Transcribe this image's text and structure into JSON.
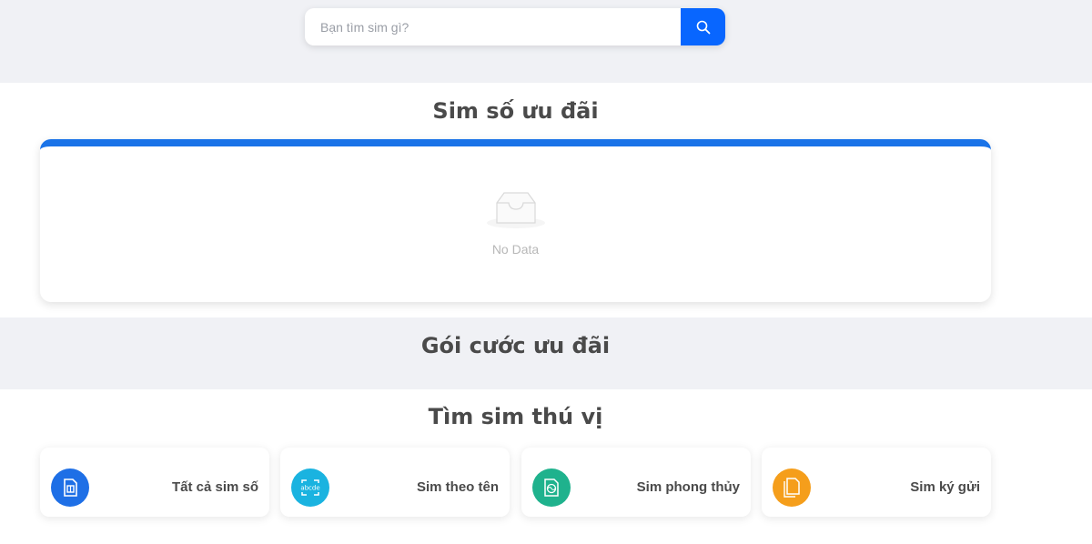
{
  "search": {
    "placeholder": "Bạn tìm sim gì?",
    "value": ""
  },
  "sections": {
    "promo_sims": {
      "title": "Sim số ưu đãi",
      "empty_text": "No Data"
    },
    "promo_packages": {
      "title": "Gói cước ưu đãi"
    },
    "interesting_sims": {
      "title": "Tìm sim thú vị",
      "categories": [
        {
          "label": "Tất cả sim số",
          "icon": "sim-card-icon"
        },
        {
          "label": "Sim theo tên",
          "icon": "name-tag-icon"
        },
        {
          "label": "Sim phong thủy",
          "icon": "feng-shui-icon"
        },
        {
          "label": "Sim ký gửi",
          "icon": "documents-icon"
        }
      ]
    }
  },
  "colors": {
    "accent": "#0866ff",
    "card_top_border": "#1a73e8",
    "band_background": "#f0f1f5"
  }
}
